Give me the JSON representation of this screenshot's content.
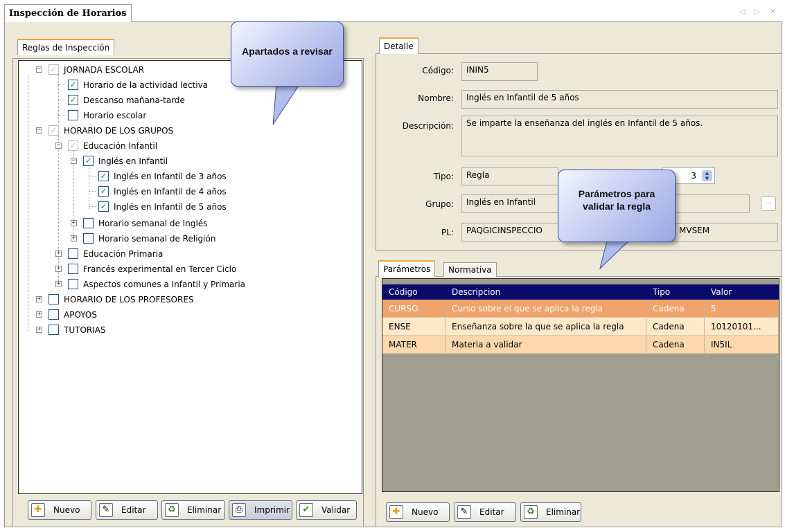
{
  "window": {
    "title": "Inspección de Horarios",
    "nav_arrows": "◁ ▷ ✕"
  },
  "left": {
    "tab": "Reglas de Inspección",
    "tree": [
      {
        "label": "JORNADA ESCOLAR",
        "checked": "gray"
      },
      {
        "label": "Horario de la actividad lectiva",
        "checked": "yes"
      },
      {
        "label": "Descanso mañana-tarde",
        "checked": "yes"
      },
      {
        "label": "Horario escolar",
        "checked": "no"
      },
      {
        "label": "HORARIO DE LOS GRUPOS",
        "checked": "gray"
      },
      {
        "label": "Educación Infantil",
        "checked": "gray"
      },
      {
        "label": "Inglés en Infantil",
        "checked": "yes"
      },
      {
        "label": "Inglés en Infantil de 3 años",
        "checked": "yes"
      },
      {
        "label": "Inglés en Infantil de 4 años",
        "checked": "yes"
      },
      {
        "label": "Inglés en Infantil de 5 años",
        "checked": "yes"
      },
      {
        "label": "Horario semanal de Inglés",
        "checked": "no"
      },
      {
        "label": "Horario semanal de Religión",
        "checked": "no"
      },
      {
        "label": "Educación Primaria",
        "checked": "no"
      },
      {
        "label": "Francés experimental en Tercer Ciclo",
        "checked": "no"
      },
      {
        "label": "Aspectos comunes a Infantil y Primaria",
        "checked": "no"
      },
      {
        "label": "HORARIO DE LOS PROFESORES",
        "checked": "no"
      },
      {
        "label": "APOYOS",
        "checked": "no"
      },
      {
        "label": "TUTORIAS",
        "checked": "no"
      }
    ],
    "buttons": {
      "new": "Nuevo",
      "edit": "Editar",
      "delete": "Eliminar",
      "print": "Imprimir",
      "validate": "Validar"
    }
  },
  "detail": {
    "tab": "Detalle",
    "labels": {
      "code": "Código:",
      "name": "Nombre:",
      "description": "Descripción:",
      "type": "Tipo:",
      "group": "Grupo:",
      "pl": "PL:"
    },
    "values": {
      "code": "ININ5",
      "name": "Inglés en Infantil de 5 años",
      "description": "Se imparte la enseñanza del inglés en Infantil de 5 años.",
      "type": "Regla",
      "order": "3",
      "group": "Inglés en Infantil",
      "pl_left": "PAQGICINSPECCIO",
      "pl_right": "MVSEM",
      "dots": "..."
    }
  },
  "params": {
    "tabs": [
      "Parámetros",
      "Normativa"
    ],
    "columns": [
      "Código",
      "Descripcion",
      "Tipo",
      "Valor"
    ],
    "rows": [
      {
        "code": "CURSO",
        "desc": "Curso sobre el que se aplica la regla",
        "type": "Cadena",
        "value": "5"
      },
      {
        "code": "ENSE",
        "desc": "Enseñanza sobre la que se aplica la regla",
        "type": "Cadena",
        "value": "10120101..."
      },
      {
        "code": "MATER",
        "desc": "Materia a validar",
        "type": "Cadena",
        "value": "IN5IL"
      }
    ],
    "buttons": {
      "new": "Nuevo",
      "edit": "Editar",
      "delete": "Eliminar"
    }
  },
  "callouts": {
    "sections": "Apartados a revisar",
    "params": "Parámetros para validar la regla"
  },
  "colors": {
    "tab_accent": "#f2a43a",
    "grid_header": "#0b0b6e",
    "row_selected": "#f0a36a",
    "row_even": "#fde9c8",
    "row_odd": "#fdd8ad",
    "grid_empty": "#a09f8f"
  }
}
